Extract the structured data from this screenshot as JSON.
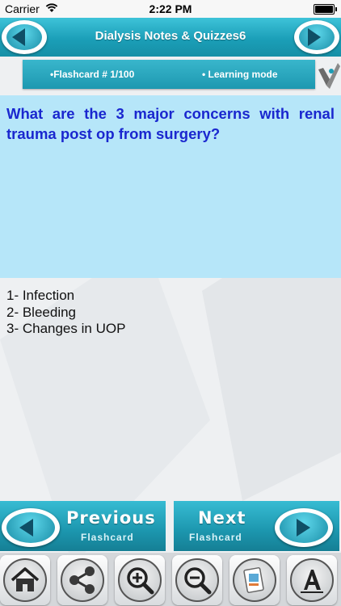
{
  "status": {
    "carrier": "Carrier",
    "time": "2:22 PM"
  },
  "header": {
    "title": "Dialysis Notes & Quizzes6"
  },
  "info": {
    "flashcard": "•Flashcard #  1/100",
    "mode": "• Learning mode"
  },
  "question": "What are the 3 major concerns with renal trauma post op from surgery?",
  "answer": [
    "1- Infection",
    "2- Bleeding",
    "3- Changes in UOP"
  ],
  "nav": {
    "previous": {
      "label": "Previous",
      "sub": "Flashcard"
    },
    "next": {
      "label": "Next",
      "sub": "Flashcard"
    }
  },
  "colors": {
    "accent": "#1d9cb5",
    "question_bg": "#b6e6f9",
    "question_text": "#1a27cf"
  },
  "toolbar_icons": [
    "home-icon",
    "share-icon",
    "zoom-in-icon",
    "zoom-out-icon",
    "card-icon",
    "font-icon"
  ]
}
